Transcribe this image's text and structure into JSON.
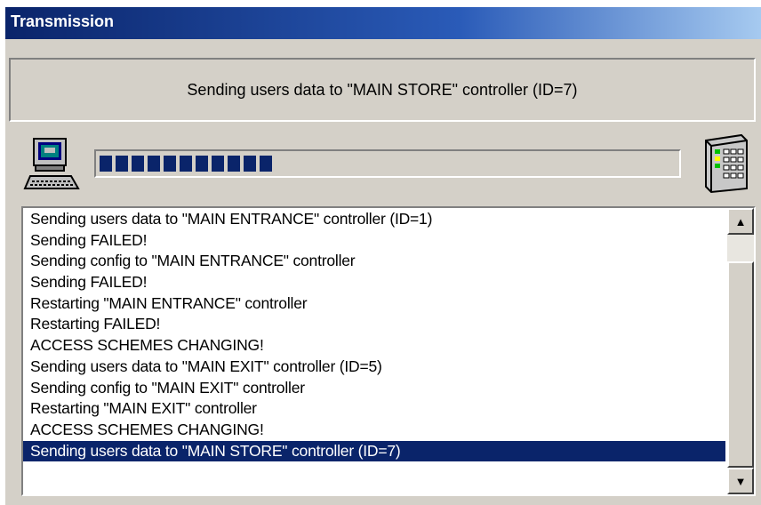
{
  "window": {
    "title": "Transmission"
  },
  "status": {
    "text": "Sending users data to \"MAIN STORE\" controller (ID=7)"
  },
  "progress": {
    "filled_blocks": 11,
    "fraction": 0.35,
    "color": "#0a246a"
  },
  "icons": {
    "left": "computer-icon",
    "right": "controller-keypad-icon"
  },
  "log": {
    "items": [
      "Sending users data to \"MAIN ENTRANCE\" controller (ID=1)",
      "Sending FAILED!",
      "Sending config to \"MAIN ENTRANCE\" controller",
      "Sending FAILED!",
      "Restarting \"MAIN ENTRANCE\" controller",
      "Restarting FAILED!",
      "ACCESS SCHEMES CHANGING!",
      "Sending users data to \"MAIN EXIT\" controller (ID=5)",
      "Sending config to \"MAIN EXIT\" controller",
      "Restarting \"MAIN EXIT\" controller",
      "ACCESS SCHEMES CHANGING!",
      "Sending users data to \"MAIN STORE\" controller (ID=7)"
    ],
    "selected_index": 11,
    "selection_color": "#0a246a"
  },
  "colors": {
    "titlebar": "#0a246a",
    "face": "#d4d0c8"
  }
}
